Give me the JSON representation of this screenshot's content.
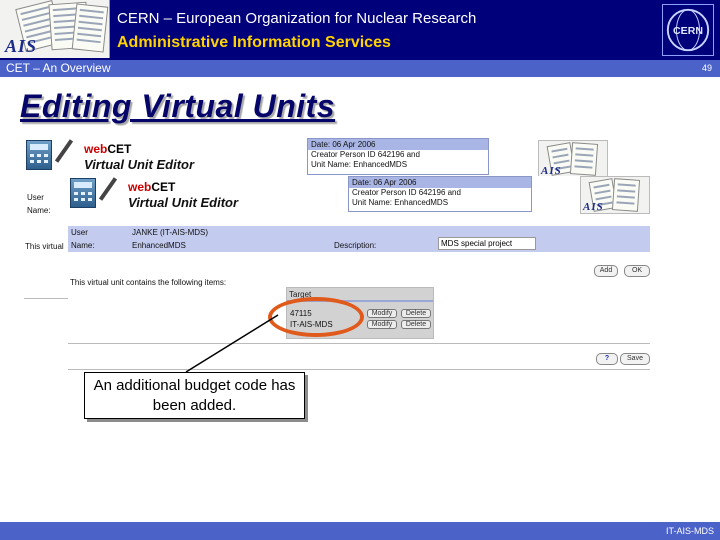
{
  "header": {
    "logo_text": "AIS",
    "organization": "CERN – European Organization for Nuclear Research",
    "service": "Administrative Information Services",
    "cern_logo_text": "CERN"
  },
  "subheader": {
    "title": "CET – An Overview",
    "slide_number": "49"
  },
  "slide": {
    "title": "Editing Virtual Units"
  },
  "screenshot_back": {
    "brand_web": "web",
    "brand_cet": "CET",
    "subtitle": "Virtual Unit Editor",
    "info": {
      "date": "Date: 06 Apr 2006",
      "creator": "Creator Person ID 642196 and",
      "unit": "Unit Name: EnhancedMDS"
    }
  },
  "screenshot_front": {
    "brand_web": "web",
    "brand_cet": "CET",
    "subtitle": "Virtual Unit Editor",
    "info": {
      "date": "Date: 06 Apr 2006",
      "creator": "Creator Person ID 642196 and",
      "unit": "Unit Name: EnhancedMDS"
    },
    "left_fragments": [
      "User",
      "Name:",
      "This virtual"
    ],
    "user_label": "User",
    "user_value": "JANKE (IT-AIS-MDS)",
    "name_label": "Name:",
    "name_value": "EnhancedMDS",
    "description_label": "Description:",
    "description_value": "MDS special project",
    "contains_text": "This virtual unit contains the following items:",
    "add_button": "Add",
    "ok_button": "OK",
    "help_button": "?",
    "save_button": "Save",
    "table": {
      "header": "Target",
      "rows": [
        {
          "target": "47115",
          "modify": "Modify",
          "delete": "Delete"
        },
        {
          "target": "IT-AIS-MDS",
          "modify": "Modify",
          "delete": "Delete"
        }
      ]
    }
  },
  "callout": {
    "text": "An additional budget code has been added."
  },
  "footer": {
    "text": "IT-AIS-MDS"
  }
}
